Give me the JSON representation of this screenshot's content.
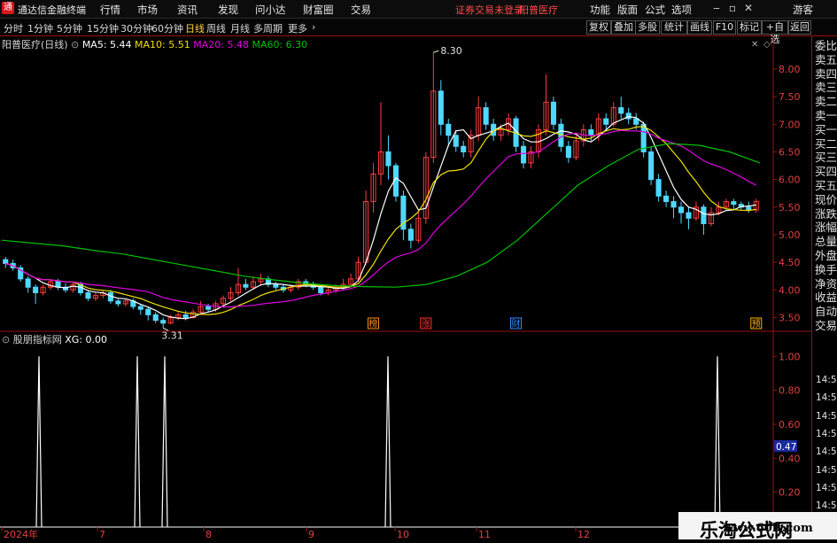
{
  "app": {
    "title": "通达信金融终端",
    "logo": "通"
  },
  "menu": [
    "行情",
    "市场",
    "资讯",
    "发现",
    "问小达",
    "财富圈",
    "交易"
  ],
  "status": {
    "trade": "证券交易未登录",
    "stock": "阳普医疗"
  },
  "right_menu": [
    "功能",
    "版面",
    "公式",
    "选项"
  ],
  "guest": "游客",
  "window_icons": {
    "minimize": "minimize-icon",
    "restore": "restore-icon",
    "close": "close-icon"
  },
  "periods": [
    "分时",
    "1分钟",
    "5分钟",
    "15分钟",
    "30分钟",
    "60分钟",
    "日线",
    "周线",
    "月线",
    "多周期",
    "更多"
  ],
  "active_period": "日线",
  "right_tools": [
    "复权",
    "叠加",
    "多股",
    "统计",
    "画线",
    "F10",
    "标记",
    "+自选",
    "返回"
  ],
  "legend": {
    "name": "阳普医疗(日线)",
    "ma5": "MA5: 5.44",
    "ma10": "MA10: 5.51",
    "ma20": "MA20: 5.48",
    "ma60": "MA60: 6.30"
  },
  "indicator": {
    "name": "股朋指标网",
    "xg": "XG: 0.00",
    "current": "0.47"
  },
  "price_ticks": [
    "8.00",
    "7.50",
    "7.00",
    "6.50",
    "6.00",
    "5.50",
    "5.00",
    "4.50",
    "4.00",
    "3.50"
  ],
  "ind_ticks": [
    "1.00",
    "0.80",
    "0.60",
    "0.40",
    "0.20"
  ],
  "date_labels": [
    "2024年",
    "7",
    "8",
    "9",
    "10",
    "11",
    "12"
  ],
  "annotations": {
    "high": "8.30",
    "low": "3.31"
  },
  "event_tags": [
    {
      "text": "榜",
      "color": "#ff8c1a"
    },
    {
      "text": "涨",
      "color": "#ff3030"
    },
    {
      "text": "财",
      "color": "#3a8cff"
    },
    {
      "text": "预",
      "color": "#ffb000"
    }
  ],
  "right_panel": [
    "委比",
    "卖五",
    "卖四",
    "卖三",
    "卖二",
    "卖一",
    "买一",
    "买二",
    "买三",
    "买四",
    "买五",
    "现价",
    "涨跌",
    "涨幅",
    "总量",
    "外盘",
    "换手",
    "净资",
    "收益",
    "自动",
    "交易"
  ],
  "trade_times": [
    "14:56",
    "14:56",
    "14:56",
    "14:56",
    "14:56",
    "14:56",
    "14:56",
    "14:56"
  ],
  "watermark": {
    "line1": "乐淘公式网",
    "line2": "www.60lt.com"
  },
  "colors": {
    "up": "#ff3c3c",
    "down": "#4fd8ff",
    "ma5": "#ffffff",
    "ma10": "#f0e000",
    "ma20": "#e000e0",
    "ma60": "#00c000",
    "axis_red": "#9a1010"
  },
  "chart_data": {
    "type": "candlestick",
    "price_range": [
      3.3,
      8.4
    ],
    "high": 8.3,
    "low": 3.31,
    "candles": [
      [
        4.55,
        4.48,
        4.6,
        4.4
      ],
      [
        4.48,
        4.4,
        4.55,
        4.35
      ],
      [
        4.4,
        4.2,
        4.45,
        4.15
      ],
      [
        4.2,
        4.05,
        4.25,
        3.95
      ],
      [
        4.05,
        3.95,
        4.1,
        3.75
      ],
      [
        3.95,
        4.05,
        4.1,
        3.9
      ],
      [
        4.05,
        4.15,
        4.2,
        4.0
      ],
      [
        4.15,
        4.05,
        4.2,
        4.0
      ],
      [
        4.05,
        4.0,
        4.12,
        3.95
      ],
      [
        4.0,
        4.1,
        4.15,
        3.95
      ],
      [
        4.1,
        3.95,
        4.15,
        3.9
      ],
      [
        3.95,
        3.85,
        4.0,
        3.8
      ],
      [
        3.85,
        3.9,
        3.95,
        3.8
      ],
      [
        3.9,
        3.95,
        4.0,
        3.85
      ],
      [
        3.95,
        3.8,
        4.0,
        3.75
      ],
      [
        3.8,
        3.75,
        3.85,
        3.7
      ],
      [
        3.75,
        3.8,
        3.85,
        3.7
      ],
      [
        3.8,
        3.7,
        3.85,
        3.65
      ],
      [
        3.7,
        3.65,
        3.75,
        3.55
      ],
      [
        3.65,
        3.55,
        3.7,
        3.45
      ],
      [
        3.55,
        3.45,
        3.6,
        3.4
      ],
      [
        3.45,
        3.4,
        3.5,
        3.31
      ],
      [
        3.4,
        3.5,
        3.55,
        3.38
      ],
      [
        3.5,
        3.55,
        3.6,
        3.45
      ],
      [
        3.55,
        3.5,
        3.62,
        3.45
      ],
      [
        3.5,
        3.6,
        3.65,
        3.48
      ],
      [
        3.6,
        3.7,
        3.8,
        3.55
      ],
      [
        3.7,
        3.65,
        3.75,
        3.6
      ],
      [
        3.65,
        3.75,
        3.8,
        3.6
      ],
      [
        3.75,
        3.85,
        3.9,
        3.7
      ],
      [
        3.85,
        3.95,
        4.05,
        3.8
      ],
      [
        3.95,
        4.1,
        4.4,
        3.9
      ],
      [
        4.1,
        4.05,
        4.2,
        4.0
      ],
      [
        4.05,
        4.15,
        4.25,
        4.0
      ],
      [
        4.15,
        4.2,
        4.3,
        4.1
      ],
      [
        4.2,
        4.1,
        4.25,
        4.05
      ],
      [
        4.1,
        4.05,
        4.15,
        4.0
      ],
      [
        4.05,
        4.0,
        4.1,
        3.95
      ],
      [
        4.0,
        4.05,
        4.1,
        3.95
      ],
      [
        4.05,
        4.15,
        4.2,
        4.0
      ],
      [
        4.15,
        4.1,
        4.2,
        4.05
      ],
      [
        4.1,
        4.05,
        4.15,
        4.0
      ],
      [
        4.05,
        3.95,
        4.1,
        3.9
      ],
      [
        3.95,
        4.0,
        4.05,
        3.9
      ],
      [
        4.0,
        4.05,
        4.1,
        3.95
      ],
      [
        4.05,
        4.1,
        4.2,
        4.0
      ],
      [
        4.1,
        4.2,
        4.3,
        4.05
      ],
      [
        4.2,
        4.5,
        4.6,
        4.15
      ],
      [
        4.5,
        5.6,
        5.8,
        4.45
      ],
      [
        5.6,
        6.1,
        6.3,
        5.4
      ],
      [
        6.1,
        6.5,
        7.4,
        5.9
      ],
      [
        6.5,
        6.25,
        6.8,
        6.0
      ],
      [
        6.25,
        5.7,
        6.3,
        5.6
      ],
      [
        5.7,
        5.1,
        5.8,
        4.9
      ],
      [
        5.1,
        4.9,
        5.2,
        4.75
      ],
      [
        4.9,
        5.3,
        5.4,
        4.85
      ],
      [
        5.3,
        6.4,
        6.5,
        5.2
      ],
      [
        6.4,
        7.6,
        8.3,
        6.3
      ],
      [
        7.6,
        7.0,
        7.8,
        6.8
      ],
      [
        7.0,
        6.8,
        7.1,
        6.6
      ],
      [
        6.8,
        6.6,
        6.9,
        6.5
      ],
      [
        6.6,
        6.5,
        6.7,
        6.4
      ],
      [
        6.5,
        6.8,
        6.9,
        6.4
      ],
      [
        6.8,
        7.3,
        7.5,
        6.7
      ],
      [
        7.3,
        7.0,
        7.4,
        6.9
      ],
      [
        7.0,
        6.8,
        7.1,
        6.7
      ],
      [
        6.8,
        6.9,
        7.0,
        6.7
      ],
      [
        6.9,
        7.1,
        7.2,
        6.8
      ],
      [
        7.1,
        6.6,
        7.15,
        6.5
      ],
      [
        6.6,
        6.3,
        6.7,
        6.2
      ],
      [
        6.3,
        6.5,
        6.6,
        6.2
      ],
      [
        6.5,
        6.9,
        7.0,
        6.4
      ],
      [
        6.9,
        7.4,
        7.9,
        6.8
      ],
      [
        7.4,
        7.0,
        7.5,
        6.9
      ],
      [
        7.0,
        6.6,
        7.1,
        6.5
      ],
      [
        6.6,
        6.4,
        6.7,
        6.3
      ],
      [
        6.4,
        6.7,
        6.8,
        6.35
      ],
      [
        6.7,
        6.9,
        7.0,
        6.6
      ],
      [
        6.9,
        6.8,
        7.0,
        6.7
      ],
      [
        6.8,
        7.1,
        7.2,
        6.7
      ],
      [
        7.1,
        7.0,
        7.2,
        6.9
      ],
      [
        7.0,
        7.3,
        7.4,
        6.95
      ],
      [
        7.3,
        7.2,
        7.5,
        7.1
      ],
      [
        7.2,
        7.1,
        7.3,
        7.0
      ],
      [
        7.1,
        7.0,
        7.2,
        6.9
      ],
      [
        7.0,
        6.5,
        7.05,
        6.4
      ],
      [
        6.5,
        6.0,
        6.6,
        5.9
      ],
      [
        6.0,
        5.7,
        6.1,
        5.6
      ],
      [
        5.7,
        5.6,
        5.8,
        5.5
      ],
      [
        5.6,
        5.5,
        5.7,
        5.3
      ],
      [
        5.5,
        5.4,
        5.6,
        5.2
      ],
      [
        5.4,
        5.3,
        5.5,
        5.1
      ],
      [
        5.3,
        5.5,
        5.6,
        5.25
      ],
      [
        5.5,
        5.2,
        5.55,
        5.0
      ],
      [
        5.2,
        5.4,
        5.5,
        5.15
      ],
      [
        5.4,
        5.5,
        5.6,
        5.35
      ],
      [
        5.5,
        5.6,
        5.65,
        5.45
      ],
      [
        5.6,
        5.55,
        5.65,
        5.45
      ],
      [
        5.55,
        5.5,
        5.6,
        5.45
      ],
      [
        5.5,
        5.45,
        5.6,
        5.4
      ],
      [
        5.45,
        5.6,
        5.65,
        5.4
      ]
    ],
    "ma60": [
      4.9,
      4.85,
      4.8,
      4.72,
      4.65,
      4.55,
      4.45,
      4.35,
      4.25,
      4.18,
      4.12,
      4.08,
      4.06,
      4.05,
      4.1,
      4.25,
      4.5,
      4.9,
      5.4,
      5.9,
      6.25,
      6.55,
      6.65,
      6.62,
      6.5,
      6.3
    ],
    "indicator_spikes": [
      0.0,
      1.0,
      0.0,
      1.0,
      0.0,
      1.0,
      0.0,
      1.0,
      0.0,
      1.0,
      0.0
    ]
  }
}
